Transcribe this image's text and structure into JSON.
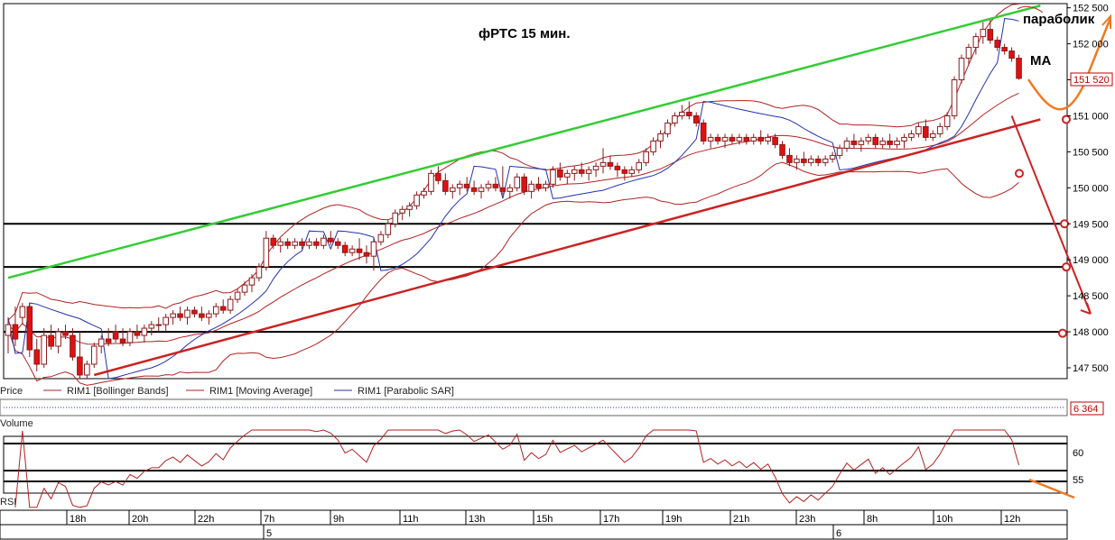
{
  "chart_data": [
    {
      "type": "candlestick",
      "title": "фРТС    15 мин.",
      "ylim": [
        147300,
        152500
      ],
      "y_ticks": [
        "147 500",
        "148 000",
        "148 500",
        "149 000",
        "149 500",
        "150 000",
        "150 500",
        "151 000",
        "151 500",
        "152 000",
        "152 500"
      ],
      "y_tick_values": [
        147500,
        148000,
        148500,
        149000,
        149500,
        150000,
        150500,
        151000,
        151500,
        152000,
        152500
      ],
      "last_price_label": "151 520",
      "legend": [
        "Price",
        "RIM1 [Bollinger Bands]",
        "RIM1 [Moving Average]",
        "RIM1 [Parabolic SAR]"
      ],
      "annotations": [
        "параболик",
        "MA"
      ],
      "horizontal_levels": [
        149500,
        148900,
        148000
      ],
      "trendlines": {
        "resistance_green": [
          [
            0,
            148750
          ],
          [
            144,
            152530
          ]
        ],
        "support_red": [
          [
            12,
            147400
          ],
          [
            144,
            150950
          ]
        ],
        "forecast_arrow_red": [
          [
            140,
            151000
          ],
          [
            151,
            148250
          ]
        ]
      },
      "circle_markers": [
        150950,
        150200,
        149500,
        148900,
        147980
      ],
      "candles": [
        [
          147950,
          148200,
          147700,
          148100
        ],
        [
          148100,
          148350,
          147800,
          147900
        ],
        [
          148200,
          148400,
          148100,
          148350
        ],
        [
          148350,
          148400,
          147650,
          147750
        ],
        [
          147750,
          147900,
          147450,
          147550
        ],
        [
          147550,
          148050,
          147500,
          147950
        ],
        [
          147950,
          148100,
          147750,
          147800
        ],
        [
          147800,
          148050,
          147700,
          148000
        ],
        [
          148000,
          148100,
          147900,
          147950
        ],
        [
          147950,
          148050,
          147600,
          147650
        ],
        [
          147650,
          148000,
          147350,
          147400
        ],
        [
          147400,
          147600,
          147350,
          147550
        ],
        [
          147550,
          147850,
          147500,
          147800
        ],
        [
          147800,
          147950,
          147700,
          147900
        ],
        [
          147900,
          148050,
          147800,
          147850
        ],
        [
          148000,
          148100,
          147850,
          147900
        ],
        [
          147900,
          148050,
          147800,
          147850
        ],
        [
          147850,
          148050,
          147800,
          148000
        ],
        [
          148000,
          148100,
          147900,
          147950
        ],
        [
          147950,
          148100,
          147850,
          148050
        ],
        [
          148050,
          148150,
          147950,
          148100
        ],
        [
          148100,
          148200,
          148000,
          148100
        ],
        [
          148100,
          148250,
          148000,
          148200
        ],
        [
          148200,
          148300,
          148100,
          148250
        ],
        [
          148250,
          148350,
          148150,
          148200
        ],
        [
          148200,
          148350,
          148100,
          148300
        ],
        [
          148300,
          148350,
          148200,
          148250
        ],
        [
          148250,
          148350,
          148150,
          148200
        ],
        [
          148200,
          148300,
          148100,
          148250
        ],
        [
          148250,
          148400,
          148200,
          148350
        ],
        [
          148350,
          148450,
          148250,
          148300
        ],
        [
          148300,
          148500,
          148250,
          148450
        ],
        [
          148450,
          148600,
          148400,
          148550
        ],
        [
          148550,
          148700,
          148500,
          148650
        ],
        [
          148650,
          148800,
          148550,
          148750
        ],
        [
          148750,
          148950,
          148700,
          148900
        ],
        [
          148900,
          149400,
          148850,
          149300
        ],
        [
          149300,
          149350,
          149150,
          149200
        ],
        [
          149200,
          149300,
          149100,
          149250
        ],
        [
          149250,
          149300,
          149150,
          149200
        ],
        [
          149200,
          149300,
          149150,
          149250
        ],
        [
          149250,
          149300,
          149150,
          149200
        ],
        [
          149200,
          149300,
          149150,
          149250
        ],
        [
          149250,
          149300,
          149150,
          149200
        ],
        [
          149200,
          149350,
          149150,
          149300
        ],
        [
          149300,
          149400,
          149200,
          149250
        ],
        [
          149250,
          149300,
          149150,
          149200
        ],
        [
          149200,
          149250,
          149050,
          149100
        ],
        [
          149100,
          149200,
          149050,
          149150
        ],
        [
          149150,
          149300,
          149000,
          149100
        ],
        [
          149100,
          149200,
          148950,
          149050
        ],
        [
          149050,
          149300,
          148850,
          149250
        ],
        [
          149250,
          149400,
          149200,
          149350
        ],
        [
          149350,
          149550,
          149300,
          149500
        ],
        [
          149500,
          149700,
          149450,
          149650
        ],
        [
          149650,
          149750,
          149550,
          149700
        ],
        [
          149700,
          149800,
          149600,
          149750
        ],
        [
          149750,
          149950,
          149700,
          149900
        ],
        [
          149900,
          150000,
          149850,
          149950
        ],
        [
          149950,
          150250,
          149900,
          150200
        ],
        [
          150200,
          150300,
          150050,
          150100
        ],
        [
          150100,
          150200,
          149900,
          149950
        ],
        [
          149950,
          150050,
          149850,
          150000
        ],
        [
          150000,
          150100,
          149900,
          150050
        ],
        [
          150050,
          150150,
          149950,
          150000
        ],
        [
          150000,
          150100,
          149900,
          149950
        ],
        [
          149950,
          150050,
          149850,
          150000
        ],
        [
          150000,
          150100,
          149950,
          150050
        ],
        [
          150050,
          150150,
          149950,
          150000
        ],
        [
          150000,
          150300,
          149900,
          149950
        ],
        [
          149950,
          150050,
          149850,
          150000
        ],
        [
          150000,
          150200,
          149950,
          150150
        ],
        [
          150150,
          150200,
          149900,
          149950
        ],
        [
          149950,
          150100,
          149850,
          150050
        ],
        [
          150050,
          150150,
          149950,
          150000
        ],
        [
          150000,
          150100,
          149950,
          150050
        ],
        [
          150050,
          150300,
          150000,
          150250
        ],
        [
          150250,
          150350,
          150100,
          150150
        ],
        [
          150150,
          150250,
          150050,
          150200
        ],
        [
          150200,
          150300,
          150100,
          150250
        ],
        [
          150250,
          150350,
          150150,
          150200
        ],
        [
          150200,
          150300,
          150100,
          150250
        ],
        [
          150250,
          150350,
          150150,
          150300
        ],
        [
          150300,
          150550,
          150200,
          150350
        ],
        [
          150350,
          150450,
          150250,
          150300
        ],
        [
          150300,
          150350,
          150150,
          150250
        ],
        [
          150250,
          150300,
          150100,
          150200
        ],
        [
          150200,
          150300,
          150150,
          150250
        ],
        [
          150250,
          150400,
          150200,
          150350
        ],
        [
          150350,
          150550,
          150300,
          150500
        ],
        [
          150500,
          150700,
          150450,
          150650
        ],
        [
          150650,
          150800,
          150550,
          150750
        ],
        [
          150750,
          150950,
          150700,
          150900
        ],
        [
          150900,
          151050,
          150850,
          151000
        ],
        [
          151000,
          151150,
          150950,
          151050
        ],
        [
          151050,
          151200,
          150950,
          151000
        ],
        [
          151000,
          151050,
          150850,
          150900
        ],
        [
          150900,
          150950,
          150600,
          150650
        ],
        [
          150650,
          150750,
          150550,
          150700
        ],
        [
          150700,
          150750,
          150600,
          150650
        ],
        [
          150650,
          150750,
          150550,
          150700
        ],
        [
          150700,
          150750,
          150600,
          150650
        ],
        [
          150650,
          150750,
          150600,
          150700
        ],
        [
          150700,
          150750,
          150600,
          150650
        ],
        [
          150650,
          150750,
          150600,
          150700
        ],
        [
          150700,
          150800,
          150600,
          150650
        ],
        [
          150650,
          150750,
          150600,
          150700
        ],
        [
          150700,
          150750,
          150550,
          150600
        ],
        [
          150600,
          150650,
          150400,
          150450
        ],
        [
          150450,
          150550,
          150300,
          150350
        ],
        [
          150350,
          150450,
          150250,
          150400
        ],
        [
          150400,
          150500,
          150300,
          150350
        ],
        [
          150350,
          150450,
          150300,
          150400
        ],
        [
          150400,
          150450,
          150300,
          150350
        ],
        [
          150350,
          150450,
          150300,
          150400
        ],
        [
          150400,
          150500,
          150350,
          150450
        ],
        [
          150450,
          150600,
          150400,
          150550
        ],
        [
          150550,
          150700,
          150500,
          150650
        ],
        [
          150650,
          150750,
          150550,
          150600
        ],
        [
          150600,
          150700,
          150500,
          150650
        ],
        [
          150650,
          150750,
          150600,
          150700
        ],
        [
          150700,
          150750,
          150550,
          150600
        ],
        [
          150600,
          150700,
          150550,
          150650
        ],
        [
          150650,
          150750,
          150550,
          150600
        ],
        [
          150600,
          150700,
          150550,
          150650
        ],
        [
          150650,
          150750,
          150550,
          150700
        ],
        [
          150700,
          150800,
          150650,
          150750
        ],
        [
          150750,
          150900,
          150700,
          150850
        ],
        [
          150850,
          150950,
          150650,
          150700
        ],
        [
          150700,
          150800,
          150650,
          150750
        ],
        [
          150750,
          150900,
          150700,
          150850
        ],
        [
          150850,
          151050,
          150800,
          151000
        ],
        [
          151000,
          151550,
          150950,
          151500
        ],
        [
          151500,
          151850,
          151450,
          151800
        ],
        [
          151800,
          152000,
          151700,
          151950
        ],
        [
          151950,
          152150,
          151850,
          152100
        ],
        [
          152100,
          152300,
          152000,
          152200
        ],
        [
          152200,
          152350,
          152000,
          152050
        ],
        [
          152050,
          152100,
          151900,
          151950
        ],
        [
          151950,
          152000,
          151850,
          151900
        ],
        [
          151900,
          151950,
          151750,
          151800
        ],
        [
          151800,
          151850,
          151500,
          151520
        ]
      ],
      "x_ticks": [
        "18h",
        "20h",
        "22h",
        "7h",
        "9h",
        "11h",
        "13h",
        "15h",
        "17h",
        "19h",
        "21h",
        "23h",
        "8h",
        "10h",
        "12h"
      ],
      "x_days": [
        "5",
        "6"
      ]
    },
    {
      "type": "bar",
      "title": "Volume",
      "last_value_label": "6 364"
    },
    {
      "type": "line",
      "title": "RSI",
      "y_ticks": [
        "55",
        "60"
      ],
      "y_tick_values": [
        55,
        60
      ],
      "levels": [
        55,
        57,
        62
      ]
    }
  ],
  "colors": {
    "bg": "#ffffff",
    "grid": "#000000",
    "candle_up_fill": "#ffffff",
    "candle_down_fill": "#e01010",
    "candle_stroke": "#8b1a1a",
    "bollinger": "#b22222",
    "moving_average": "#b22222",
    "parabolic_sar": "#2233aa",
    "green_line": "#33cc33",
    "red_line": "#cc2222",
    "orange_annotation": "#f07a20",
    "volume_dots": "#2233aa"
  }
}
